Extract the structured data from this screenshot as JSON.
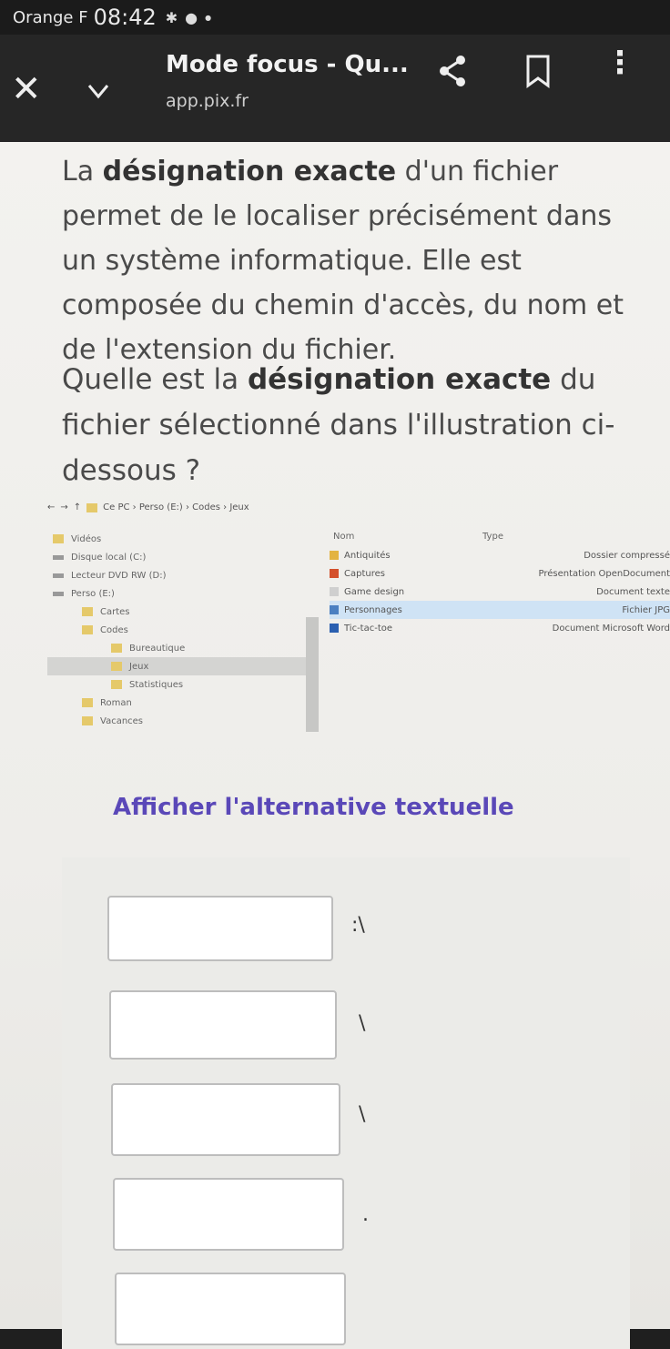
{
  "status_bar": {
    "carrier": "Orange F",
    "time": "08:42"
  },
  "browser": {
    "title": "Mode focus - Qu...",
    "url": "app.pix.fr"
  },
  "question": {
    "intro_1": "La ",
    "intro_bold": "désignation exacte",
    "intro_2": " d'un fichier permet de le localiser précisément dans un système informatique. Elle est composée du chemin d'accès, du nom et de l'extension du fichier.",
    "ask_1": "Quelle est la ",
    "ask_bold": "désignation exacte",
    "ask_2": " du fichier sélectionné dans l'illustration ci-dessous ?"
  },
  "explorer": {
    "breadcrumb": [
      "Ce PC",
      "Perso (E:)",
      "Codes",
      "Jeux"
    ],
    "tree": [
      {
        "label": "Vidéos",
        "indent": 0
      },
      {
        "label": "Disque local (C:)",
        "indent": 0
      },
      {
        "label": "Lecteur DVD RW (D:)",
        "indent": 0
      },
      {
        "label": "Perso (E:)",
        "indent": 0
      },
      {
        "label": "Cartes",
        "indent": 1
      },
      {
        "label": "Codes",
        "indent": 1
      },
      {
        "label": "Bureautique",
        "indent": 2
      },
      {
        "label": "Jeux",
        "indent": 2
      },
      {
        "label": "Statistiques",
        "indent": 2
      },
      {
        "label": "Roman",
        "indent": 1
      },
      {
        "label": "Vacances",
        "indent": 1
      }
    ],
    "selected_tree": "Jeux",
    "columns": {
      "name": "Nom",
      "type": "Type"
    },
    "files": [
      {
        "name": "Antiquités",
        "type": "Dossier compressé",
        "icon_color": "#e3b341"
      },
      {
        "name": "Captures",
        "type": "Présentation OpenDocument",
        "icon_color": "#d4502b"
      },
      {
        "name": "Game design",
        "type": "Document texte",
        "icon_color": "#cfcfcf"
      },
      {
        "name": "Personnages",
        "type": "Fichier JPG",
        "icon_color": "#4a7fc1"
      },
      {
        "name": "Tic-tac-toe",
        "type": "Document Microsoft Word",
        "icon_color": "#2b5fb0"
      }
    ],
    "selected_file": "Personnages"
  },
  "alt_text_link": "Afficher l'alternative textuelle",
  "answer": {
    "separators": [
      ":\\",
      "\\",
      "\\",
      "."
    ],
    "inputs": [
      "",
      "",
      "",
      "",
      ""
    ]
  }
}
